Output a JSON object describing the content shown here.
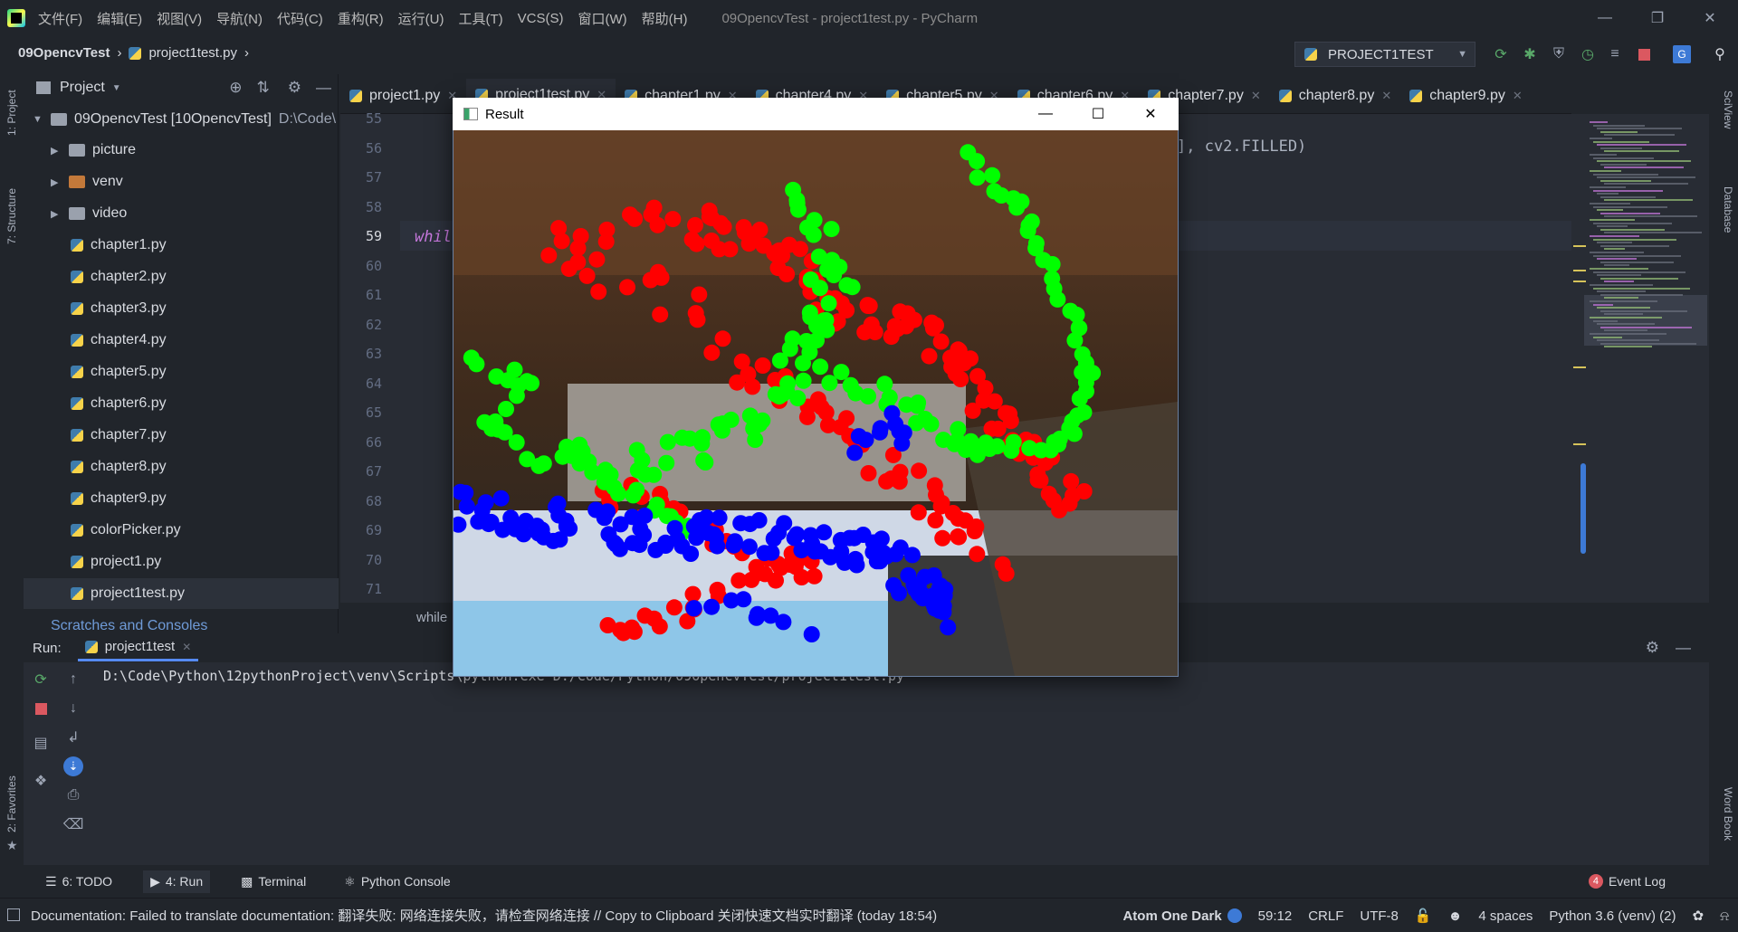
{
  "window": {
    "title": "09OpencvTest - project1test.py - PyCharm",
    "menu": [
      "文件(F)",
      "编辑(E)",
      "视图(V)",
      "导航(N)",
      "代码(C)",
      "重构(R)",
      "运行(U)",
      "工具(T)",
      "VCS(S)",
      "窗口(W)",
      "帮助(H)"
    ]
  },
  "breadcrumb": {
    "project": "09OpencvTest",
    "file": "project1test.py"
  },
  "toolbar": {
    "run_config": "PROJECT1TEST"
  },
  "sidebar_left": {
    "project_label": "1: Project",
    "structure_label": "7: Structure",
    "favorites_label": "2: Favorites"
  },
  "sidebar_right": {
    "sciview": "SciView",
    "database": "Database",
    "wordbook": "Word Book"
  },
  "project_panel": {
    "title": "Project",
    "root": "09OpencvTest [10OpencvTest]",
    "root_path": "D:\\Code\\",
    "items": [
      {
        "label": "picture",
        "kind": "folder"
      },
      {
        "label": "venv",
        "kind": "folder-orange"
      },
      {
        "label": "video",
        "kind": "folder"
      },
      {
        "label": "chapter1.py",
        "kind": "py"
      },
      {
        "label": "chapter2.py",
        "kind": "py"
      },
      {
        "label": "chapter3.py",
        "kind": "py"
      },
      {
        "label": "chapter4.py",
        "kind": "py"
      },
      {
        "label": "chapter5.py",
        "kind": "py"
      },
      {
        "label": "chapter6.py",
        "kind": "py"
      },
      {
        "label": "chapter7.py",
        "kind": "py"
      },
      {
        "label": "chapter8.py",
        "kind": "py"
      },
      {
        "label": "chapter9.py",
        "kind": "py"
      },
      {
        "label": "colorPicker.py",
        "kind": "py"
      },
      {
        "label": "project1.py",
        "kind": "py"
      },
      {
        "label": "project1test.py",
        "kind": "py"
      }
    ],
    "scratches": "Scratches and Consoles"
  },
  "editor_tabs": [
    "project1.py",
    "project1test.py",
    "chapter1.py",
    "chapter4.py",
    "chapter5.py",
    "chapter6.py",
    "chapter7.py",
    "chapter8.py",
    "chapter9.py"
  ],
  "editor": {
    "line_numbers": [
      "55",
      "56",
      "57",
      "58",
      "59",
      "60",
      "61",
      "62",
      "63",
      "64",
      "65",
      "66",
      "67",
      "68",
      "69",
      "70",
      "71"
    ],
    "current_line": "59",
    "code_56_tail": "], cv2.FILLED)",
    "code_59": "whil",
    "breadcrumb_bottom": "while"
  },
  "run_panel": {
    "label": "Run:",
    "tab": "project1test",
    "command": "D:\\Code\\Python\\12pythonProject\\venv\\Scripts\\python.exe D:/Code/Python/09OpencvTest/project1test.py"
  },
  "bottom_tabs": [
    {
      "label": "6: TODO",
      "icon": "list-icon"
    },
    {
      "label": "4: Run",
      "icon": "run-icon"
    },
    {
      "label": "Terminal",
      "icon": "terminal-icon"
    },
    {
      "label": "Python Console",
      "icon": "python-icon"
    }
  ],
  "event_log": {
    "count": "4",
    "label": "Event Log"
  },
  "status": {
    "message": "Documentation: Failed to translate documentation: 翻译失败: 网络连接失败，请检查网络连接 // Copy to Clipboard   关闭快速文档实时翻译 (today 18:54)",
    "theme": "Atom One Dark",
    "position": "59:12",
    "line_sep": "CRLF",
    "encoding": "UTF-8",
    "indent": "4 spaces",
    "interpreter": "Python 3.6 (venv) (2)"
  },
  "result_window": {
    "title": "Result",
    "dot_colors": {
      "red": "#ff0000",
      "green": "#00ff00",
      "blue": "#0000ff"
    }
  },
  "colors": {
    "accent": "#568af2",
    "bg": "#21252b",
    "editor_bg": "#282c34"
  }
}
